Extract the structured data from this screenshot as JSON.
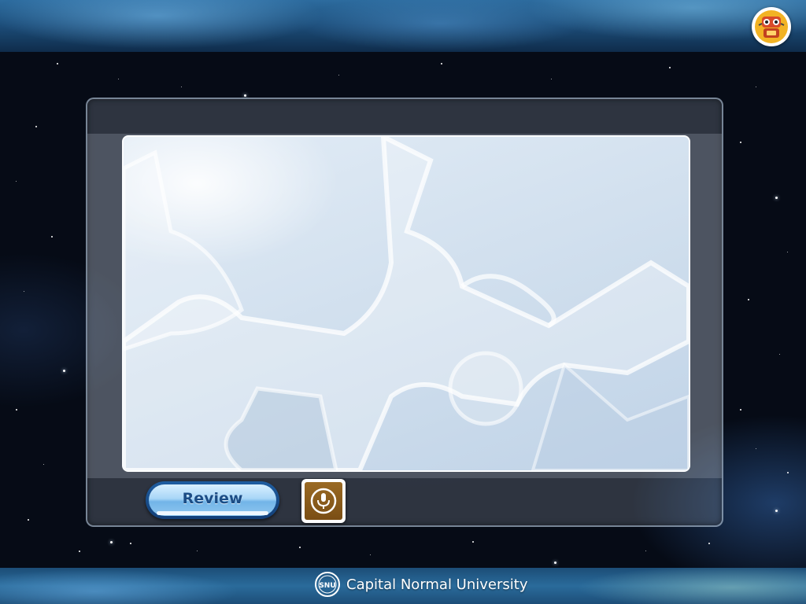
{
  "header": {
    "robot_icon": "robot-icon"
  },
  "panel": {
    "review_label": "Review",
    "record_icon": "microphone-icon"
  },
  "footer": {
    "university_name": "Capital Normal University",
    "logo_text": "SNU",
    "logo_icon": "university-logo-icon"
  },
  "colors": {
    "background": "#060b16",
    "nebula_blue": "#2d6c9f",
    "review_button_text": "#1b4c85",
    "record_button": "#8a5c1c",
    "content_frame": "#d4e2f0"
  }
}
